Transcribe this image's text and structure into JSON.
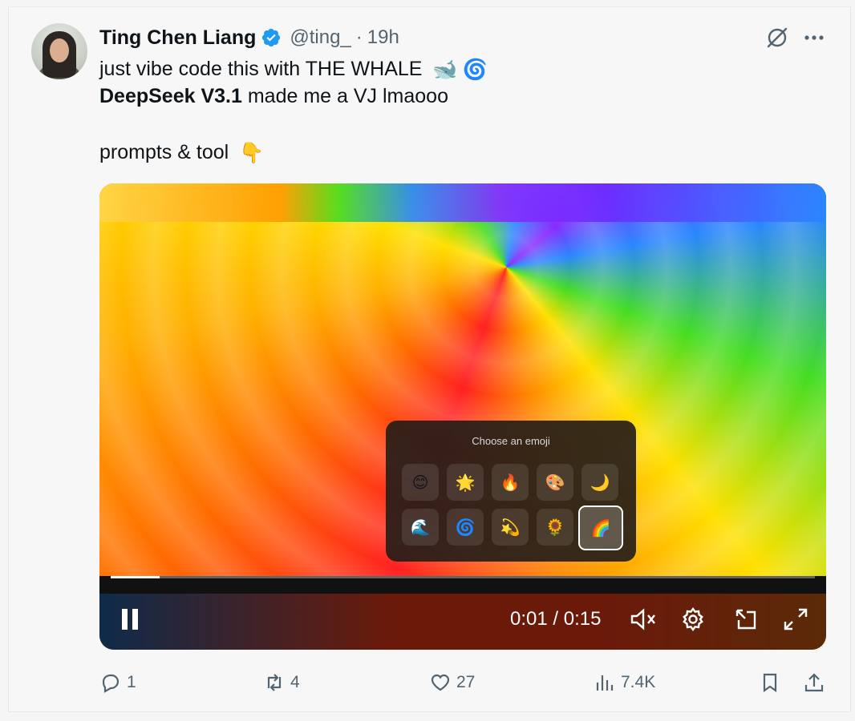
{
  "author": {
    "name": "Ting Chen Liang",
    "handle": "@ting_",
    "separator": "·",
    "time": "19h"
  },
  "tweet": {
    "line1": "just vibe code this with THE WHALE",
    "line2_bold": "DeepSeek V3.1",
    "line2_rest": " made me a VJ lmaooo",
    "line3": "prompts & tool"
  },
  "icons": {
    "whale": "🐋",
    "swirl": "🌀",
    "point_down": "👇"
  },
  "video": {
    "picker_title": "Choose an emoji",
    "emojis_row1": [
      "😊",
      "🌟",
      "🔥",
      "🎨",
      "🌙"
    ],
    "emojis_row2": [
      "🌊",
      "🌀",
      "💫",
      "🌻",
      "🌈"
    ],
    "selected_index": 9,
    "current_time": "0:01",
    "duration": "0:15",
    "time_label": "0:01 / 0:15",
    "progress_fraction": 0.07
  },
  "stats": {
    "replies": "1",
    "reposts": "4",
    "likes": "27",
    "views": "7.4K"
  },
  "colors": {
    "verified": "#1d9bf0",
    "muted_text": "#536471",
    "text": "#0f1419"
  }
}
